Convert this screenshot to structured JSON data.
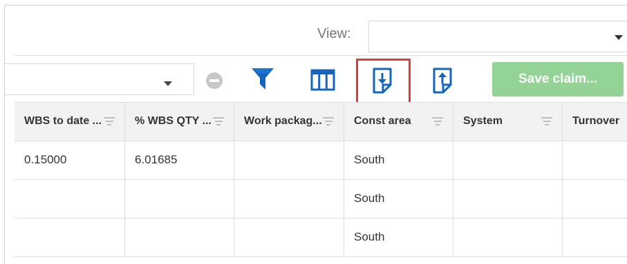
{
  "view": {
    "label": "View:",
    "selected": ""
  },
  "toolbar": {
    "left_select_value": "",
    "remove_icon": "minus-circle-icon",
    "filter_icon": "filter-icon",
    "columns_icon": "columns-icon",
    "export_icon": "export-download-icon",
    "import_icon": "import-upload-icon",
    "save_label": "Save claim...",
    "save_color": "#93d395",
    "accent_color": "#1565c0",
    "highlight_color": "#e53935"
  },
  "grid": {
    "columns": [
      "WBS to date ...",
      "% WBS QTY ...",
      "Work packag...",
      "Const area",
      "System",
      "Turnover"
    ],
    "rows": [
      [
        "0.15000",
        "6.01685",
        "",
        "South",
        "",
        ""
      ],
      [
        "",
        "",
        "",
        "South",
        "",
        ""
      ],
      [
        "",
        "",
        "",
        "South",
        "",
        ""
      ]
    ]
  }
}
